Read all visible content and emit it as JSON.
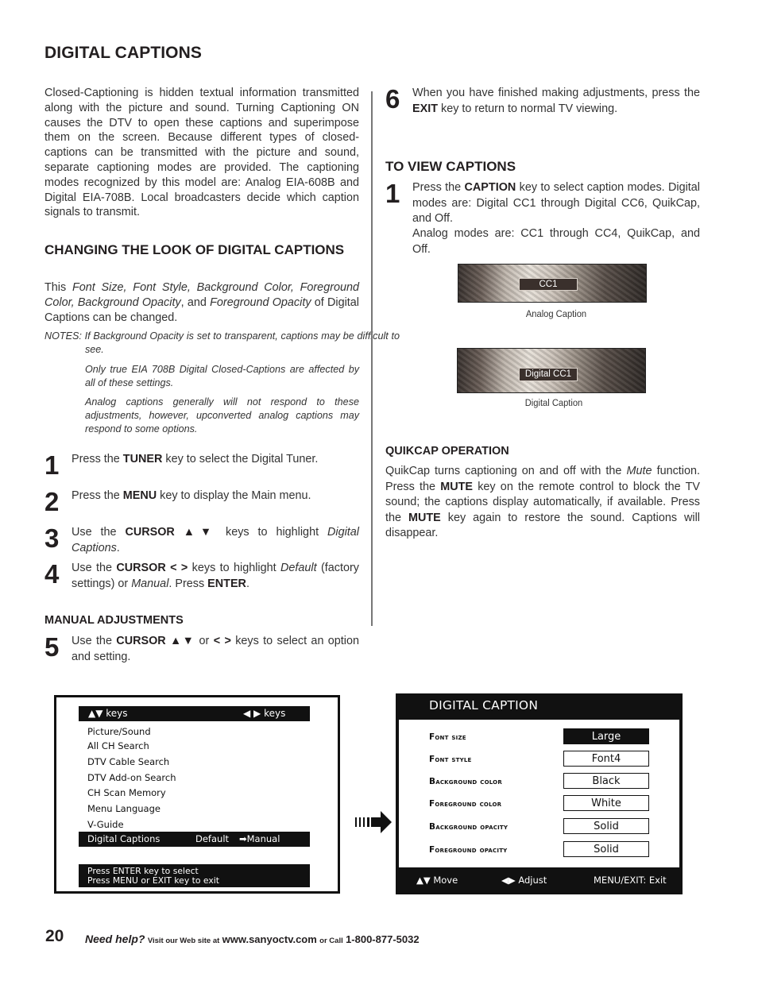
{
  "page": {
    "title": "DIGITAL CAPTIONS",
    "intro": "Closed-Captioning is hidden textual information transmitted along with the picture and sound. Turning Captioning ON causes the DTV to open these captions and superimpose them on the screen. Because different types of closed-captions can be transmitted with the picture and sound, separate captioning modes are provided. The captioning modes recognized by this model are: Analog EIA-608B and Digital EIA-708B. Local broadcasters decide which caption signals to transmit."
  },
  "changing_look": {
    "heading": "CHANGING THE LOOK OF DIGITAL CAPTIONS",
    "text_prefix": "This ",
    "text_italic1": "Font Size, Font Style, Background Color, Foreground Color, Background Opacity",
    "text_mid": ", and ",
    "text_italic2": "Foreground Opacity",
    "text_suffix": " of Digital Captions can be changed.",
    "notes_label": "NOTES:",
    "notes": [
      "If Background Opacity is set to transparent, captions may be difficult to see.",
      "Only true EIA 708B Digital Closed-Captions are affected by all of these settings.",
      "Analog captions generally will not respond to these adjustments, however, upconverted analog captions may respond to some options."
    ]
  },
  "steps": [
    {
      "num": "1",
      "pre": "Press the ",
      "key": "TUNER",
      "post": " key to select the Digital Tuner."
    },
    {
      "num": "2",
      "pre": "Press the ",
      "key": "MENU",
      "post": " key to display the Main menu."
    },
    {
      "num": "3",
      "pre": "Use the ",
      "key": "CURSOR ▲▼",
      "post": " keys to highlight ",
      "italic": "Digital Captions",
      "end": "."
    },
    {
      "num": "4",
      "pre": "Use the ",
      "key": "CURSOR < >",
      "post": " keys to highlight ",
      "italic": "Default",
      "mid": " (factory settings) or ",
      "italic2": "Manual",
      "mid2": ". Press ",
      "key2": "ENTER",
      "end": "."
    }
  ],
  "manual_adjustments": {
    "heading": "MANUAL ADJUSTMENTS",
    "step5": {
      "num": "5",
      "pre": "Use the ",
      "key": "CURSOR ▲▼",
      "mid": " or ",
      "key2": "< >",
      "post": " keys to select an option and setting."
    },
    "step6": {
      "num": "6",
      "pre": "When you have finished making adjustments, press the ",
      "key": "EXIT",
      "post": " key to return to normal TV viewing."
    }
  },
  "view_captions": {
    "heading": "TO VIEW CAPTIONS",
    "step1": {
      "num": "1",
      "pre": "Press the ",
      "key": "CAPTION",
      "post": " key to select caption modes. Digital modes are: Digital CC1 through Digital CC6, QuikCap, and Off.",
      "analog": "Analog modes are: CC1 through CC4, QuikCap, and Off."
    },
    "figures": [
      {
        "caption_text": "CC1",
        "label": "Analog Caption"
      },
      {
        "caption_text": "Digital CC1",
        "label": "Digital Caption"
      }
    ]
  },
  "quikcap": {
    "heading": "QUIKCAP OPERATION",
    "t1": "QuikCap turns captioning on and off with the ",
    "t1_italic": "Mute",
    "t2": " function. Press the ",
    "key1": "MUTE",
    "t3": " key on the remote control to block the TV sound; the captions display automatically, if available. Press the ",
    "key2": "MUTE",
    "t4": " key again to restore the sound. Captions will disappear."
  },
  "main_menu": {
    "header_left": "▲▼ keys",
    "header_right": "◀ ▶ keys",
    "items": [
      "Picture/Sound",
      "All CH Search",
      "DTV Cable Search",
      "DTV Add-on Search",
      "CH Scan Memory",
      "Menu Language",
      "V-Guide"
    ],
    "selected_item": "Digital Captions",
    "selected_option1": "Default",
    "selected_option2": "➡Manual",
    "footer_line1": "Press ENTER key to select",
    "footer_line2": "Press MENU or EXIT key to exit"
  },
  "caption_menu": {
    "title": "DIGITAL CAPTION",
    "rows": [
      {
        "label": "Font size",
        "value": "Large",
        "selected": true
      },
      {
        "label": "Font style",
        "value": "Font4",
        "selected": false
      },
      {
        "label": "Background color",
        "value": "Black",
        "selected": false
      },
      {
        "label": "Foreground color",
        "value": "White",
        "selected": false
      },
      {
        "label": "Background opacity",
        "value": "Solid",
        "selected": false
      },
      {
        "label": "Foreground opacity",
        "value": "Solid",
        "selected": false
      }
    ],
    "footer_move": "▲▼ Move",
    "footer_adjust": "◀▶ Adjust",
    "footer_exit": "MENU/EXIT: Exit"
  },
  "footer": {
    "page_number": "20",
    "help": "Need help?",
    "visit": "Visit our Web site at",
    "url": "www.sanyoctv.com",
    "call": "or Call",
    "phone": "1-800-877-5032"
  }
}
